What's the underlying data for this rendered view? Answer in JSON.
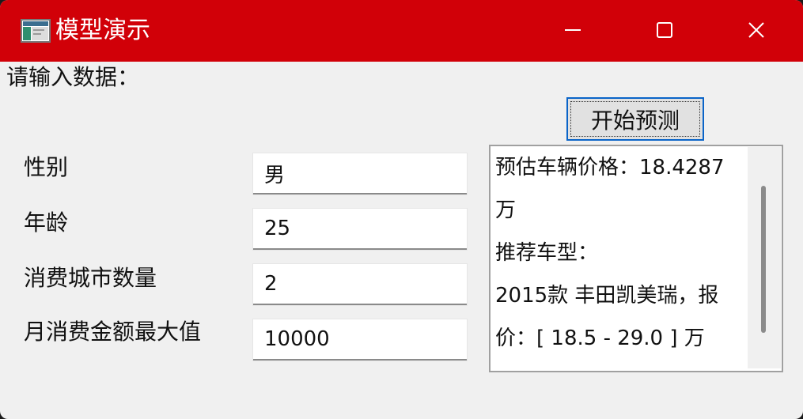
{
  "window": {
    "title": "模型演示",
    "title_color": "#d10008",
    "controls": [
      "minimize-icon",
      "maximize-icon",
      "close-icon"
    ]
  },
  "prompt": "请输入数据：",
  "predict_button": "开始预测",
  "fields": [
    {
      "label": "性别",
      "value": "男"
    },
    {
      "label": "年龄",
      "value": "25"
    },
    {
      "label": "消费城市数量",
      "value": "2"
    },
    {
      "label": "月消费金额最大值",
      "value": "10000"
    }
  ],
  "result": {
    "lines": [
      "预估车辆价格：18.4287",
      "万",
      "推荐车型：",
      "2015款 丰田凯美瑞，报",
      "价：[ 18.5 - 29.0 ] 万"
    ]
  }
}
